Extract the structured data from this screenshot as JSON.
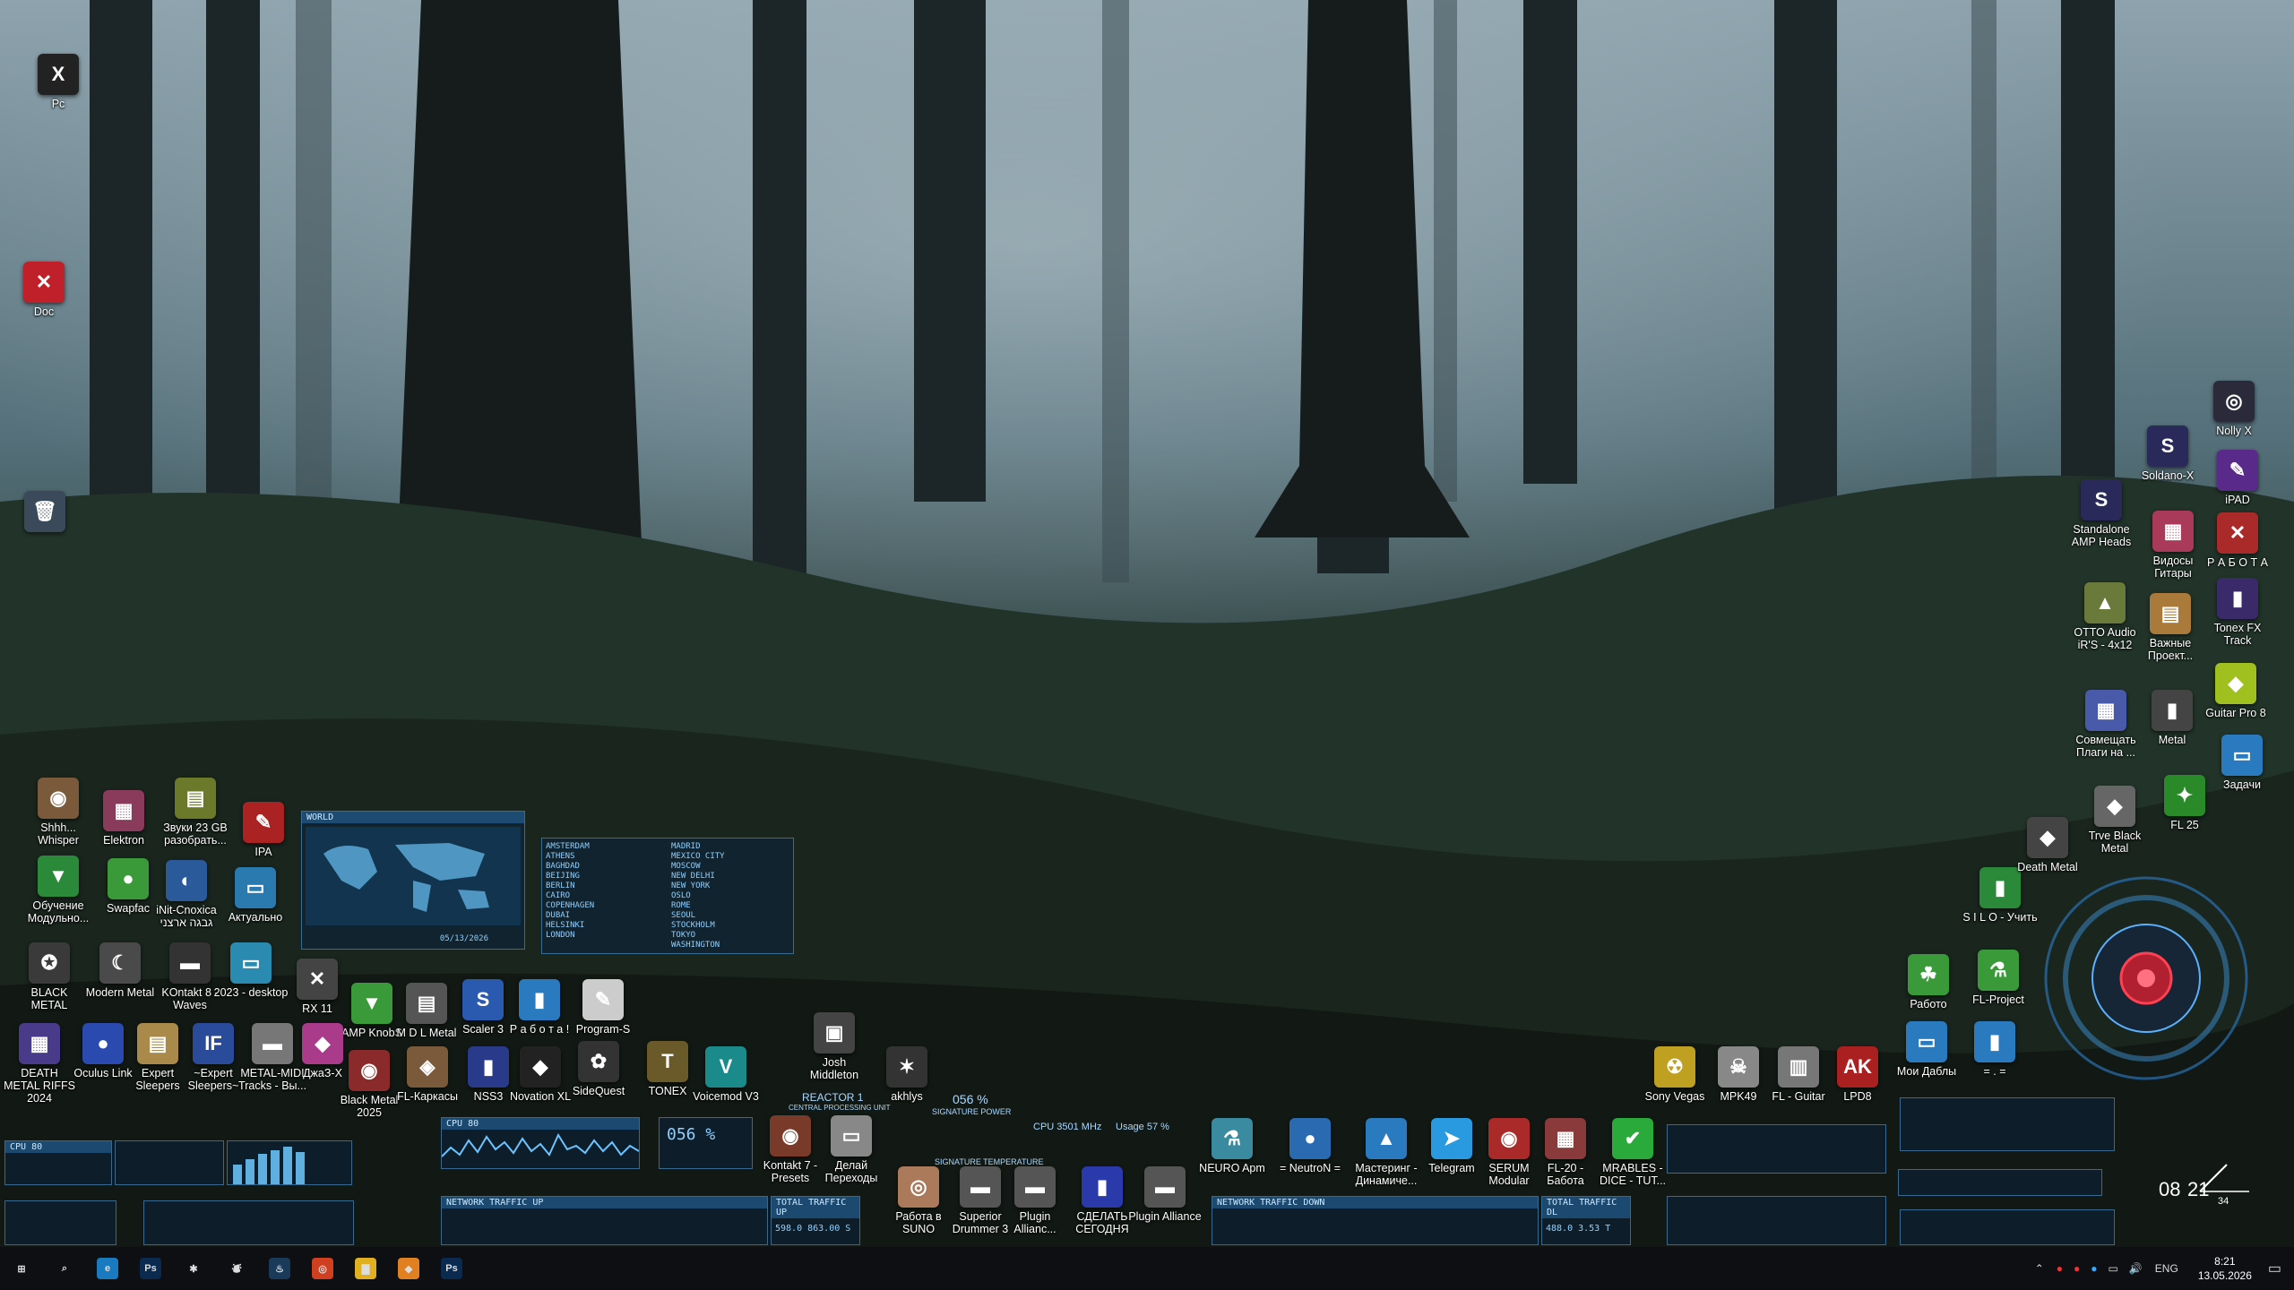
{
  "desktop": {
    "icons": [
      {
        "label": "Pc",
        "glyph": "X",
        "color": "#222"
      },
      {
        "label": "Doc",
        "glyph": "✕",
        "color": "#c0202a"
      },
      {
        "label": "",
        "glyph": "🗑",
        "color": "#3a4a5a"
      },
      {
        "label": "Shhh... Whisper",
        "glyph": "◉",
        "color": "#7a5a3a"
      },
      {
        "label": "Elektron",
        "glyph": "▦",
        "color": "#8a3a5a"
      },
      {
        "label": "Звуки 23 GB разобрать...",
        "glyph": "▤",
        "color": "#6a7a2a"
      },
      {
        "label": "IPA",
        "glyph": "✎",
        "color": "#aa2222"
      },
      {
        "label": "Обучение Модульно...",
        "glyph": "▼",
        "color": "#2a8a3a"
      },
      {
        "label": "Swapfac",
        "glyph": "●",
        "color": "#3a9a3a"
      },
      {
        "label": "iNit-Cnoxica גבגה ארצני",
        "glyph": "◐",
        "color": "#2a5a9a"
      },
      {
        "label": "Актуально",
        "glyph": "▭",
        "color": "#2a7ab0"
      },
      {
        "label": "BLACK METAL",
        "glyph": "✪",
        "color": "#3a3a3a"
      },
      {
        "label": "Modern Metal",
        "glyph": "☾",
        "color": "#4a4a4a"
      },
      {
        "label": "KOntakt 8 - Waves",
        "glyph": "▬",
        "color": "#333"
      },
      {
        "label": "2023 - desktop",
        "glyph": "▭",
        "color": "#2a8ab0"
      },
      {
        "label": "RX 11",
        "glyph": "✕",
        "color": "#444"
      },
      {
        "label": "AMP KnobS",
        "glyph": "▼",
        "color": "#3a9a3a"
      },
      {
        "label": "M D L Metal",
        "glyph": "▤",
        "color": "#555"
      },
      {
        "label": "Scaler 3",
        "glyph": "S",
        "color": "#2a5ab0"
      },
      {
        "label": "Р а б о т а !",
        "glyph": "▮",
        "color": "#2a7ac0"
      },
      {
        "label": "Program-S",
        "glyph": "✎",
        "color": "#ccc"
      },
      {
        "label": "DEATH METAL RIFFS 2024",
        "glyph": "▦",
        "color": "#4a3a8a"
      },
      {
        "label": "Oculus Link",
        "glyph": "●",
        "color": "#2a4ab0"
      },
      {
        "label": "Expert Sleepers",
        "glyph": "▤",
        "color": "#aa8a4a"
      },
      {
        "label": "~Expert Sleepers~",
        "glyph": "IF",
        "color": "#2a4a9a"
      },
      {
        "label": "METAL-MIDI Tracks - Вы...",
        "glyph": "▬",
        "color": "#777"
      },
      {
        "label": "ДжаЗ-Х",
        "glyph": "◆",
        "color": "#aa3a8a"
      },
      {
        "label": "Black Metal 2025",
        "glyph": "◉",
        "color": "#8a2a2a"
      },
      {
        "label": "FL-Каркасы",
        "glyph": "◈",
        "color": "#7a5a3a"
      },
      {
        "label": "NSS3",
        "glyph": "▮",
        "color": "#2a3a8a"
      },
      {
        "label": "Novation XL",
        "glyph": "◆",
        "color": "#222"
      },
      {
        "label": "SideQuest",
        "glyph": "✿",
        "color": "#333"
      },
      {
        "label": "TONEX",
        "glyph": "T",
        "color": "#6a5a2a"
      },
      {
        "label": "Voicemod V3",
        "glyph": "V",
        "color": "#1a8a8a"
      },
      {
        "label": "Josh Middleton",
        "glyph": "▣",
        "color": "#444"
      },
      {
        "label": "akhlys",
        "glyph": "✶",
        "color": "#333"
      },
      {
        "label": "Kontakt 7 - Presets",
        "glyph": "◉",
        "color": "#7a3a2a"
      },
      {
        "label": "Делай Переходы",
        "glyph": "▭",
        "color": "#888"
      },
      {
        "label": "Работа в SUNO",
        "glyph": "◎",
        "color": "#aa7a5a"
      },
      {
        "label": "Superior Drummer 3",
        "glyph": "▬",
        "color": "#555"
      },
      {
        "label": "Plugin Allianc...",
        "glyph": "▬",
        "color": "#555"
      },
      {
        "label": "СДЕЛАТЬ СЕГОДНЯ",
        "glyph": "▮",
        "color": "#2a3aaa"
      },
      {
        "label": "Plugin Alliance",
        "glyph": "▬",
        "color": "#555"
      },
      {
        "label": "NEURO Apm",
        "glyph": "⚗",
        "color": "#3a8aa0"
      },
      {
        "label": "= NeutroN =",
        "glyph": "●",
        "color": "#2a6ab0"
      },
      {
        "label": "Мастеринг - Динамиче...",
        "glyph": "▲",
        "color": "#2a7ac0"
      },
      {
        "label": "Telegram",
        "glyph": "➤",
        "color": "#2a9ae0"
      },
      {
        "label": "SERUM Modular",
        "glyph": "◉",
        "color": "#aa2a2a"
      },
      {
        "label": "FL-20 - Бабота",
        "glyph": "▦",
        "color": "#8a3a3a"
      },
      {
        "label": "MRABLES - DICE - TUT...",
        "glyph": "✔",
        "color": "#2aaa3a"
      },
      {
        "label": "Sony Vegas",
        "glyph": "☢",
        "color": "#c0a020"
      },
      {
        "label": "MPK49",
        "glyph": "☠",
        "color": "#888"
      },
      {
        "label": "FL - Guitar",
        "glyph": "▥",
        "color": "#777"
      },
      {
        "label": "LPD8",
        "glyph": "AK",
        "color": "#aa2020"
      },
      {
        "label": "Мои Даблы",
        "glyph": "▭",
        "color": "#2a7ac0"
      },
      {
        "label": "= . =",
        "glyph": "▮",
        "color": "#2a7ac0"
      },
      {
        "label": "Работо",
        "glyph": "☘",
        "color": "#3a9a3a"
      },
      {
        "label": "FL-Project",
        "glyph": "⚗",
        "color": "#3a9a3a"
      },
      {
        "label": "S I L O - Учить",
        "glyph": "▮",
        "color": "#2a8a3a"
      },
      {
        "label": "Death Metal",
        "glyph": "◆",
        "color": "#444"
      },
      {
        "label": "Trve Black Metal",
        "glyph": "◆",
        "color": "#666"
      },
      {
        "label": "FL 25",
        "glyph": "✦",
        "color": "#2a8a2a"
      },
      {
        "label": "Совмещать Плаги на ...",
        "glyph": "▦",
        "color": "#4a5aaa"
      },
      {
        "label": "Metal",
        "glyph": "▮",
        "color": "#444"
      },
      {
        "label": "Задачи",
        "glyph": "▭",
        "color": "#2a7ac0"
      },
      {
        "label": "OTTO Audio iR'S - 4x12",
        "glyph": "▲",
        "color": "#6a7a3a"
      },
      {
        "label": "Важные Проект...",
        "glyph": "▤",
        "color": "#aa7a3a"
      },
      {
        "label": "Guitar Pro 8",
        "glyph": "◆",
        "color": "#a0c020"
      },
      {
        "label": "Standalone AMP Heads",
        "glyph": "S",
        "color": "#2a2a5a"
      },
      {
        "label": "Видосы Гитары",
        "glyph": "▦",
        "color": "#aa3a5a"
      },
      {
        "label": "Tonex FX Track",
        "glyph": "▮",
        "color": "#3a2a6a"
      },
      {
        "label": "Soldano-X",
        "glyph": "S",
        "color": "#2a2a5a"
      },
      {
        "label": "iPAD",
        "glyph": "✎",
        "color": "#5a2a8a"
      },
      {
        "label": "Р А Б О Т А",
        "glyph": "✕",
        "color": "#aa2a2a"
      },
      {
        "label": "Nolly X",
        "glyph": "◎",
        "color": "#2a2a3a"
      }
    ]
  },
  "widgets": {
    "timezones": {
      "cities": [
        "AMSTERDAM",
        "ATHENS",
        "BAGHDAD",
        "BEIJING",
        "BERLIN",
        "CAIRO",
        "COPENHAGEN",
        "DUBAI",
        "HELSINKI",
        "LONDON"
      ],
      "cities2": [
        "MADRID",
        "MEXICO CITY",
        "MOSCOW",
        "NEW DELHI",
        "NEW YORK",
        "OSLO",
        "ROME",
        "SEOUL",
        "STOCKHOLM",
        "TOKYO",
        "WASHINGTON"
      ],
      "date": "05/13/2026"
    },
    "cpu_label": "CPU 3501 MHz",
    "usage_label": "Usage 57 %",
    "reactor": "REACTOR 1",
    "signature_power": "056 %",
    "signature_power_label": "SIGNATURE POWER",
    "signature_temp_label": "SIGNATURE TEMPERATURE",
    "network_up": "NETWORK TRAFFIC UP",
    "network_down": "NETWORK TRAFFIC DOWN",
    "total_up": "TOTAL TRAFFIC UP",
    "total_dl": "TOTAL TRAFFIC DL",
    "total_up_val": "598.0  863.00 S",
    "total_dl_val": "488.0  3.53 T",
    "cpu_panel": "CPU 80",
    "usage_pct": "056 %",
    "central_unit": "CENTRAL PROCESSING UNIT",
    "clock_hours": "08",
    "clock_minutes": "21",
    "clock_seconds": "34"
  },
  "taskbar": {
    "apps": [
      {
        "name": "start",
        "glyph": "⊞",
        "color": "transparent"
      },
      {
        "name": "search",
        "glyph": "⌕",
        "color": "transparent"
      },
      {
        "name": "edge",
        "glyph": "e",
        "color": "#1a7ac0"
      },
      {
        "name": "photoshop",
        "glyph": "Ps",
        "color": "#0a2a50"
      },
      {
        "name": "app-gear",
        "glyph": "✱",
        "color": "transparent"
      },
      {
        "name": "app-fox",
        "glyph": "⛇",
        "color": "transparent"
      },
      {
        "name": "steam",
        "glyph": "♨",
        "color": "#1a3a5a"
      },
      {
        "name": "chrome",
        "glyph": "◎",
        "color": "#d04020"
      },
      {
        "name": "explorer",
        "glyph": "▇",
        "color": "#e0b020"
      },
      {
        "name": "fl-studio",
        "glyph": "◆",
        "color": "#e08020"
      },
      {
        "name": "photoshop-2",
        "glyph": "Ps",
        "color": "#0a2a50"
      }
    ],
    "tray": {
      "language": "ENG",
      "time": "8:21",
      "date": "13.05.2026"
    }
  }
}
